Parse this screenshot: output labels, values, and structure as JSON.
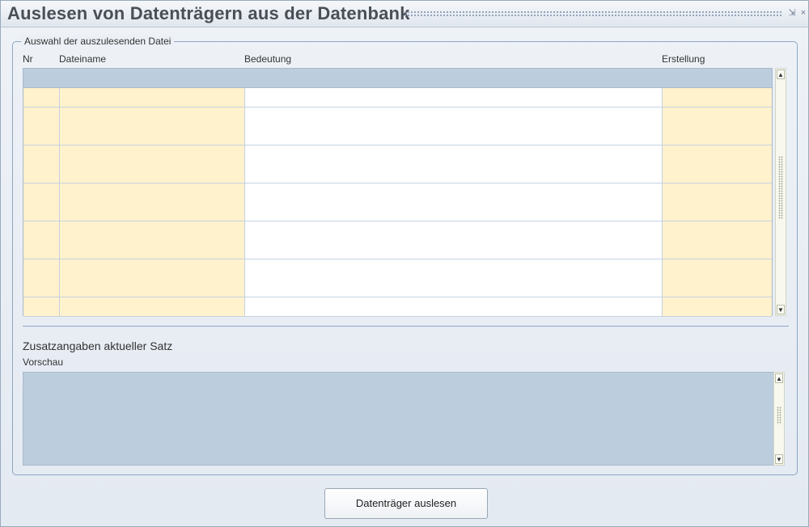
{
  "window": {
    "title": "Auslesen von Datenträgern aus der Datenbank",
    "minimize_icon": "minimize-icon",
    "close_icon": "close-icon",
    "minimize_glyph": "⇲",
    "close_glyph": "×"
  },
  "file_selection": {
    "legend": "Auswahl der auszulesenden Datei",
    "columns": {
      "nr": "Nr",
      "dateiname": "Dateiname",
      "bedeutung": "Bedeutung",
      "erstellung": "Erstellung"
    },
    "rows": [
      {
        "nr": "",
        "dateiname": "",
        "bedeutung": "",
        "erstellung": ""
      },
      {
        "nr": "",
        "dateiname": "",
        "bedeutung": "",
        "erstellung": ""
      },
      {
        "nr": "",
        "dateiname": "",
        "bedeutung": "",
        "erstellung": ""
      },
      {
        "nr": "",
        "dateiname": "",
        "bedeutung": "",
        "erstellung": ""
      },
      {
        "nr": "",
        "dateiname": "",
        "bedeutung": "",
        "erstellung": ""
      },
      {
        "nr": "",
        "dateiname": "",
        "bedeutung": "",
        "erstellung": ""
      },
      {
        "nr": "",
        "dateiname": "",
        "bedeutung": "",
        "erstellung": ""
      },
      {
        "nr": "",
        "dateiname": "",
        "bedeutung": "",
        "erstellung": ""
      },
      {
        "nr": "",
        "dateiname": "",
        "bedeutung": "",
        "erstellung": ""
      },
      {
        "nr": "",
        "dateiname": "",
        "bedeutung": "",
        "erstellung": ""
      },
      {
        "nr": "",
        "dateiname": "",
        "bedeutung": "",
        "erstellung": ""
      },
      {
        "nr": "",
        "dateiname": "",
        "bedeutung": "",
        "erstellung": ""
      }
    ]
  },
  "details": {
    "section_title": "Zusatzangaben aktueller Satz",
    "preview_label": "Vorschau",
    "preview_text": ""
  },
  "scroll": {
    "up_glyph": "▲",
    "down_glyph": "▼"
  },
  "actions": {
    "read_button": "Datenträger auslesen"
  },
  "colors": {
    "editable_cell": "#fff2cc",
    "header_row": "#bccddd",
    "title_text": "#4a4f56",
    "frame_border": "#8ea6c2"
  }
}
